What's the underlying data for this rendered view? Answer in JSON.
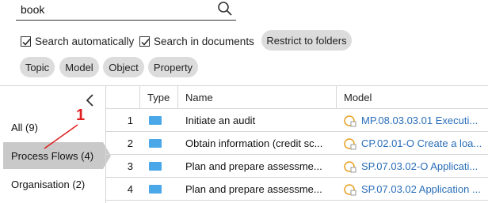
{
  "search": {
    "value": "book",
    "placeholder": ""
  },
  "options": {
    "search_automatically": {
      "label": "Search automatically",
      "checked": true
    },
    "search_in_documents": {
      "label": "Search in documents",
      "checked": true
    },
    "restrict_to_folders": "Restrict to folders"
  },
  "filter_chips": [
    "Topic",
    "Model",
    "Object",
    "Property"
  ],
  "nav": {
    "items": [
      {
        "label": "All (9)",
        "selected": false
      },
      {
        "label": "Process Flows (4)",
        "selected": true
      },
      {
        "label": "Organisation (2)",
        "selected": false
      }
    ]
  },
  "annotation": {
    "number": "1",
    "color": "#e02020"
  },
  "table": {
    "columns": [
      "",
      "Type",
      "Name",
      "Model"
    ],
    "rows": [
      {
        "num": "1",
        "type_icon": "folder-icon",
        "name": "Initiate an audit",
        "model": "MP.08.03.03.01 Executi..."
      },
      {
        "num": "2",
        "type_icon": "folder-icon",
        "name": "Obtain information (credit sc...",
        "model": "CP.02.01-O Create a loa..."
      },
      {
        "num": "3",
        "type_icon": "folder-icon",
        "name": "Plan and prepare assessme...",
        "model": "SP.07.03.02-O Applicati..."
      },
      {
        "num": "4",
        "type_icon": "folder-icon",
        "name": "Plan and prepare assessme...",
        "model": "SP.07.03.02 Application ..."
      }
    ]
  },
  "colors": {
    "link": "#2a6eb8",
    "type_icon": "#4aa8e8",
    "model_icon": "#e8a020",
    "selected_bg": "#c9c9c9",
    "chip_bg": "#dcdcdc"
  }
}
